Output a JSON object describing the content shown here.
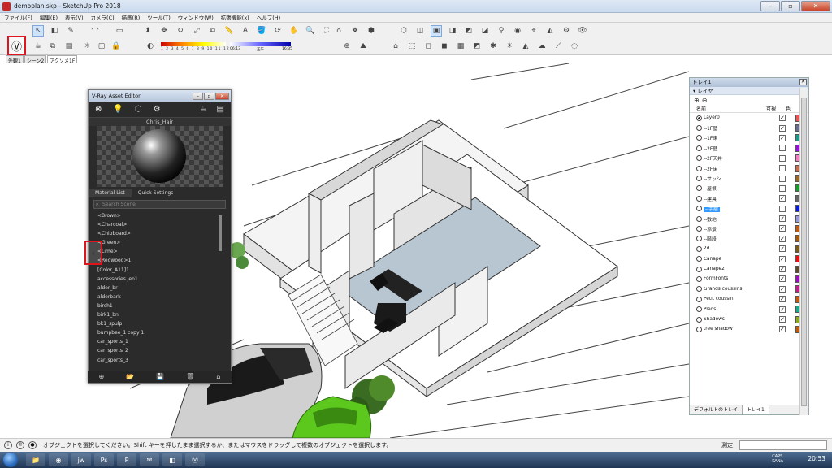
{
  "window": {
    "title": "demoplan.skp - SketchUp Pro 2018"
  },
  "menu": [
    "ファイル(F)",
    "編集(E)",
    "表示(V)",
    "カメラ(C)",
    "描画(R)",
    "ツール(T)",
    "ウィンドウ(W)",
    "拡張機能(x)",
    "ヘルプ(H)"
  ],
  "shadow": {
    "month_ticks": "1 2 3 4 5 6 7 8 9 10 11 12",
    "time_start": "06:13",
    "time_mid": "正午",
    "time_end": "16:35"
  },
  "scene_tabs": [
    "外観1",
    "シーン2",
    "アクソメ1F"
  ],
  "vray": {
    "title": "V-Ray Asset Editor",
    "material_name": "Chris_Hair",
    "tab_material_list": "Material List",
    "tab_quick_settings": "Quick Settings",
    "search_placeholder": "Search Scene",
    "materials": [
      "<Brown>",
      "<Charcoal>",
      "<Chipboard>",
      "<Green>",
      "<Lime>",
      "<Redwood>1",
      "[Color_A11]1",
      "accessories jen1",
      "alder_br",
      "alderbark",
      "birch1",
      "birk1_bn",
      "bk1_spulp",
      "bumpbee_1 copy 1",
      "car_sports_1",
      "car_sports_2",
      "car_sports_3"
    ]
  },
  "tray": {
    "title": "トレイ1",
    "panel": "レイヤ",
    "col_name": "名前",
    "col_visible": "可視",
    "col_color": "色",
    "layers": [
      {
        "name": "Layer0",
        "visible": true,
        "color": "#e85555",
        "active": true
      },
      {
        "name": "--1F壁",
        "visible": true,
        "color": "#6a6e8e"
      },
      {
        "name": "--1F床",
        "visible": true,
        "color": "#1b9a8a"
      },
      {
        "name": "--2F壁",
        "visible": false,
        "color": "#9b10d8"
      },
      {
        "name": "--2F天井",
        "visible": false,
        "color": "#f27fc0"
      },
      {
        "name": "--2F床",
        "visible": false,
        "color": "#c07050"
      },
      {
        "name": "--サッシ",
        "visible": false,
        "color": "#9a6a2a"
      },
      {
        "name": "--屋根",
        "visible": false,
        "color": "#1c9a2c"
      },
      {
        "name": "--建具",
        "visible": true,
        "color": "#666666"
      },
      {
        "name": "--手摺",
        "visible": false,
        "color": "#0a1ad8",
        "selected": true
      },
      {
        "name": "--敷地",
        "visible": true,
        "color": "#9a9ad8"
      },
      {
        "name": "--添景",
        "visible": true,
        "color": "#c05a10"
      },
      {
        "name": "--階段",
        "visible": true,
        "color": "#a05a0a"
      },
      {
        "name": "2d",
        "visible": true,
        "color": "#7a5a1a"
      },
      {
        "name": "Canapé",
        "visible": true,
        "color": "#e81010"
      },
      {
        "name": "Canapé2",
        "visible": true,
        "color": "#5a4a2a"
      },
      {
        "name": "FormFonts",
        "visible": true,
        "color": "#9a10b8"
      },
      {
        "name": "Grands coussins",
        "visible": true,
        "color": "#c0208a"
      },
      {
        "name": "Petit coussin",
        "visible": true,
        "color": "#c05a10"
      },
      {
        "name": "Pieds",
        "visible": true,
        "color": "#1aa88a"
      },
      {
        "name": "Shadows",
        "visible": true,
        "color": "#8aa820"
      },
      {
        "name": "tree shadow",
        "visible": true,
        "color": "#c05a10"
      }
    ],
    "tab_default": "デフォルトのトレイ",
    "tab_tray1": "トレイ1"
  },
  "status": {
    "message": "オブジェクトを選択してください。Shift キーを押したまま選択するか、またはマウスをドラッグして複数のオブジェクトを選択します。",
    "measure_label": "測定"
  },
  "taskbar": {
    "time": "20:53",
    "ime_top": "CAPS",
    "ime_bottom": "KANA"
  }
}
